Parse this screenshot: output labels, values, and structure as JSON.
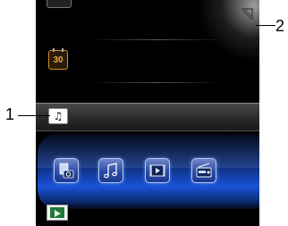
{
  "calendar": {
    "day": "30",
    "icon": "calendar-icon"
  },
  "selected_item": {
    "icon": "music-note-icon",
    "glyph": "♫"
  },
  "panel": {
    "apps": [
      {
        "name": "photo-camera-icon"
      },
      {
        "name": "music-icon"
      },
      {
        "name": "video-play-icon"
      },
      {
        "name": "radio-icon"
      }
    ]
  },
  "bottom": {
    "icon": "video-player-icon"
  },
  "corner": {
    "icon": "minimize-corner-icon"
  },
  "callouts": {
    "one": "1",
    "two": "2"
  },
  "colors": {
    "panel_blue": "#1a52d8",
    "calendar_accent": "#e8a84a",
    "video_green": "#1f7a3a"
  }
}
